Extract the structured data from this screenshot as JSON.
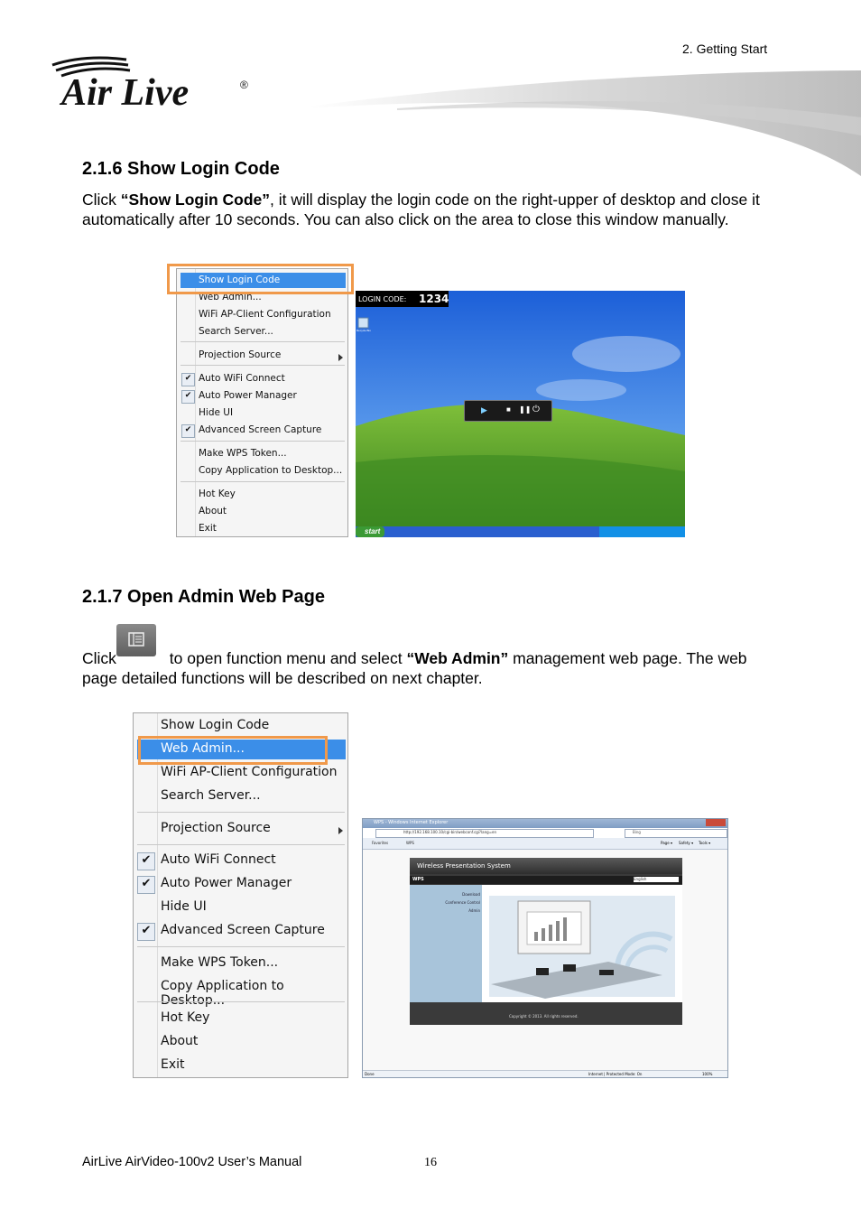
{
  "header": {
    "section": "2. Getting Start",
    "logo_text": "Air Live",
    "logo_mark": "®"
  },
  "section_216": {
    "title": "2.1.6 Show Login Code",
    "p_pre": "Click ",
    "p_bold": "“Show Login Code”",
    "p_post": ", it will display the login code on the right-upper of desktop and close it automatically after 10 seconds. You can also click on the area to close this window manually."
  },
  "menu1": {
    "items": [
      {
        "label": "Show Login Code",
        "checked": false,
        "selected": true
      },
      {
        "label": "Web Admin...",
        "checked": false
      },
      {
        "label": "WiFi AP-Client Configuration",
        "checked": false
      },
      {
        "label": "Search Server...",
        "checked": false
      },
      {
        "label": "Projection Source",
        "checked": false,
        "submenu": true
      },
      {
        "label": "Auto WiFi Connect",
        "checked": true
      },
      {
        "label": "Auto Power Manager",
        "checked": true
      },
      {
        "label": "Hide UI",
        "checked": false
      },
      {
        "label": "Advanced Screen Capture",
        "checked": true
      },
      {
        "label": "Make WPS Token...",
        "checked": false
      },
      {
        "label": "Copy Application to Desktop...",
        "checked": false
      },
      {
        "label": "Hot Key",
        "checked": false
      },
      {
        "label": "About",
        "checked": false
      },
      {
        "label": "Exit",
        "checked": false
      }
    ],
    "check_glyph": "✔"
  },
  "desktop": {
    "login_code_label": "LOGIN CODE:",
    "login_code_value": "1234",
    "start_label": "start",
    "icon_label": "Recycle Bin"
  },
  "section_217": {
    "title": "2.1.7 Open Admin Web Page",
    "p_pre": "Click",
    "p_mid": " to open function menu and select ",
    "p_bold": "“Web Admin”",
    "p_post": " management web page.   The web page detailed functions will be described on next chapter."
  },
  "menu2": {
    "items": [
      {
        "label": "Show Login Code",
        "checked": false
      },
      {
        "label": "Web Admin...",
        "checked": false,
        "selected": true
      },
      {
        "label": "WiFi AP-Client Configuration",
        "checked": false
      },
      {
        "label": "Search Server...",
        "checked": false
      },
      {
        "label": "Projection Source",
        "checked": false,
        "submenu": true
      },
      {
        "label": "Auto WiFi Connect",
        "checked": true
      },
      {
        "label": "Auto Power Manager",
        "checked": true
      },
      {
        "label": "Hide UI",
        "checked": false
      },
      {
        "label": "Advanced Screen Capture",
        "checked": true
      },
      {
        "label": "Make WPS Token...",
        "checked": false
      },
      {
        "label": "Copy Application to Desktop...",
        "checked": false
      },
      {
        "label": "Hot Key",
        "checked": false
      },
      {
        "label": "About",
        "checked": false
      },
      {
        "label": "Exit",
        "checked": false
      }
    ]
  },
  "browser": {
    "title": "WPS - Windows Internet Explorer",
    "url": "http://192.168.100.10/cgi-bin/webconf.cgi?lang=en",
    "search": "Bing",
    "favorites": "Favorites",
    "tab": "WPS",
    "cmd_page": "Page ▾",
    "cmd_safety": "Safety ▾",
    "cmd_tools": "Tools ▾",
    "site_title": "Wireless Presentation System",
    "bar_label": "WPS",
    "lang": "English",
    "nav": [
      "Download",
      "Conference Control",
      "Admin"
    ],
    "copyright": "Copyright © 2013. All rights reserved.",
    "status_left": "Done",
    "status_zone": "Internet | Protected Mode: On",
    "zoom": "100%"
  },
  "footer": {
    "manual": "AirLive AirVideo-100v2 User’s Manual",
    "page": "16"
  }
}
